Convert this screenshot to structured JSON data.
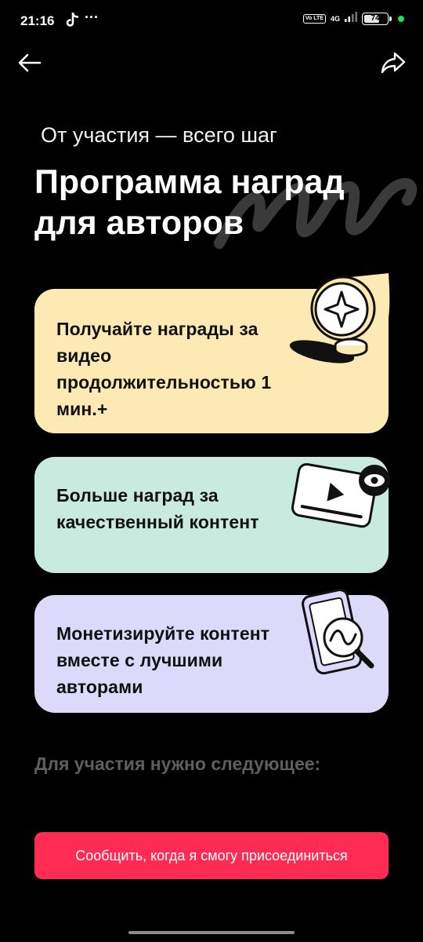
{
  "status_bar": {
    "time": "21:16",
    "app_icon": "tiktok-icon",
    "more": "···",
    "volte": "Vo LTE",
    "network": "4G",
    "battery": "74",
    "battery_level_percent": 74,
    "indicator_color": "#2bd76a"
  },
  "header": {
    "back_icon": "arrow-left-icon",
    "share_icon": "share-arrow-icon"
  },
  "intro": {
    "subtitle": "От участия — всего шаг",
    "title": "Программа наград для авторов"
  },
  "cards": [
    {
      "text": "Получайте награды за видео продолжительностью 1 мин.+",
      "color": "#fde9b3",
      "icon": "star-coin-icon"
    },
    {
      "text": "Больше наград за качественный контент",
      "color": "#c9ebdf",
      "icon": "video-player-eye-icon"
    },
    {
      "text": "Монетизируйте контент вместе с лучшими авторами",
      "color": "#ddd9fb",
      "icon": "phone-magnifier-chart-icon"
    }
  ],
  "requirements_heading": "Для участия нужно следующее:",
  "cta": {
    "label": "Сообщить, когда я смогу присоединиться",
    "color": "#fe2c55"
  }
}
